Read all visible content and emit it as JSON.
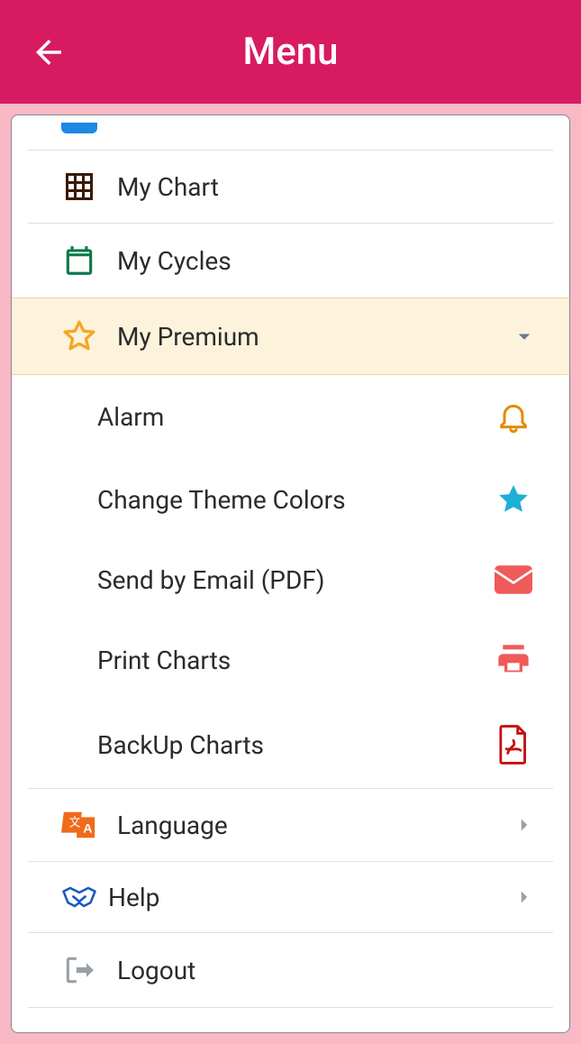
{
  "header": {
    "title": "Menu"
  },
  "menu": {
    "my_chart": "My Chart",
    "my_cycles": "My Cycles",
    "my_premium": "My Premium",
    "language": "Language",
    "help": "Help",
    "logout": "Logout"
  },
  "premium_sub": {
    "alarm": "Alarm",
    "change_theme": "Change Theme Colors",
    "send_email": "Send by Email (PDF)",
    "print_charts": "Print Charts",
    "backup_charts": "BackUp Charts"
  }
}
